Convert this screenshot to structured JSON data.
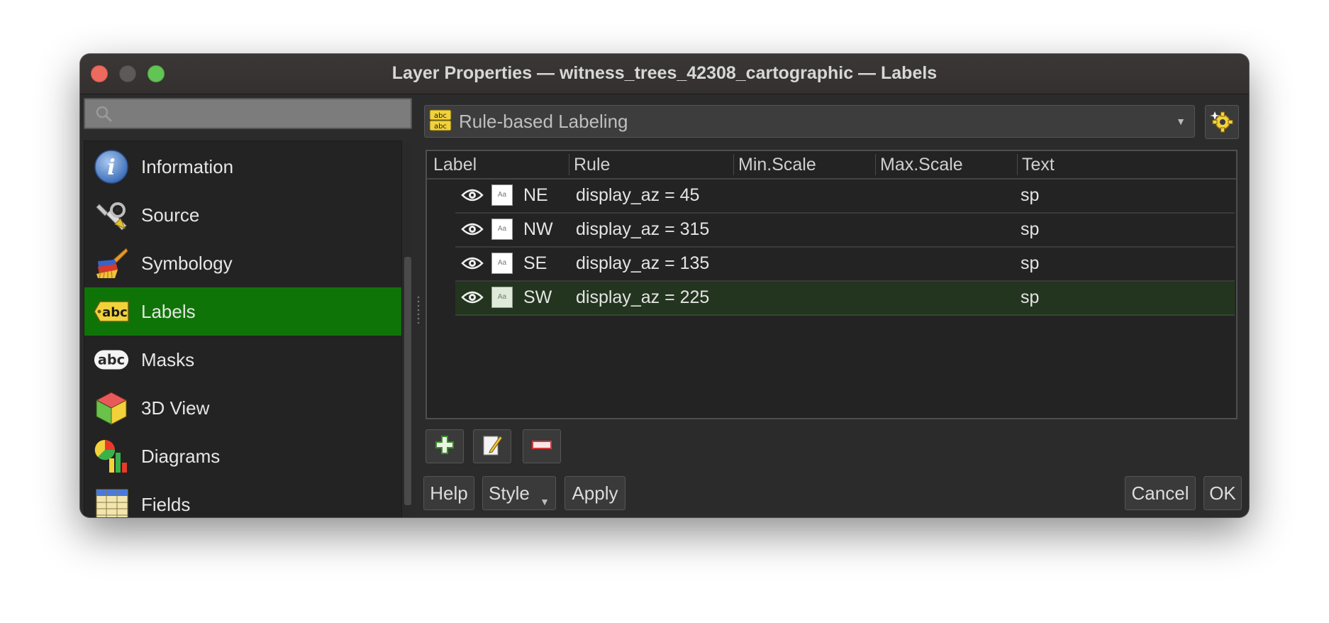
{
  "window": {
    "title": "Layer Properties — witness_trees_42308_cartographic — Labels"
  },
  "search": {
    "placeholder": ""
  },
  "sidebar": {
    "items": [
      {
        "label": "Information",
        "icon": "information-icon"
      },
      {
        "label": "Source",
        "icon": "source-icon"
      },
      {
        "label": "Symbology",
        "icon": "symbology-icon"
      },
      {
        "label": "Labels",
        "icon": "labels-icon",
        "active": true
      },
      {
        "label": "Masks",
        "icon": "masks-icon"
      },
      {
        "label": "3D View",
        "icon": "3d-view-icon"
      },
      {
        "label": "Diagrams",
        "icon": "diagrams-icon"
      },
      {
        "label": "Fields",
        "icon": "fields-icon"
      }
    ]
  },
  "labeling": {
    "mode": "Rule-based Labeling"
  },
  "rules_table": {
    "columns": [
      "Label",
      "Rule",
      "Min.Scale",
      "Max.Scale",
      "Text"
    ],
    "rows": [
      {
        "label": "NE",
        "rule": "display_az = 45",
        "min_scale": "",
        "max_scale": "",
        "text": "sp"
      },
      {
        "label": "NW",
        "rule": "display_az = 315",
        "min_scale": "",
        "max_scale": "",
        "text": "sp"
      },
      {
        "label": "SE",
        "rule": "display_az = 135",
        "min_scale": "",
        "max_scale": "",
        "text": "sp"
      },
      {
        "label": "SW",
        "rule": "display_az = 225",
        "min_scale": "",
        "max_scale": "",
        "text": "sp"
      }
    ],
    "selected_row": 3
  },
  "buttons": {
    "help": "Help",
    "style": "Style",
    "apply": "Apply",
    "cancel": "Cancel",
    "ok": "OK"
  },
  "colors": {
    "active_nav": "#0f7407",
    "window_bg": "#2b2b2b",
    "selected_row": "#23341f"
  }
}
